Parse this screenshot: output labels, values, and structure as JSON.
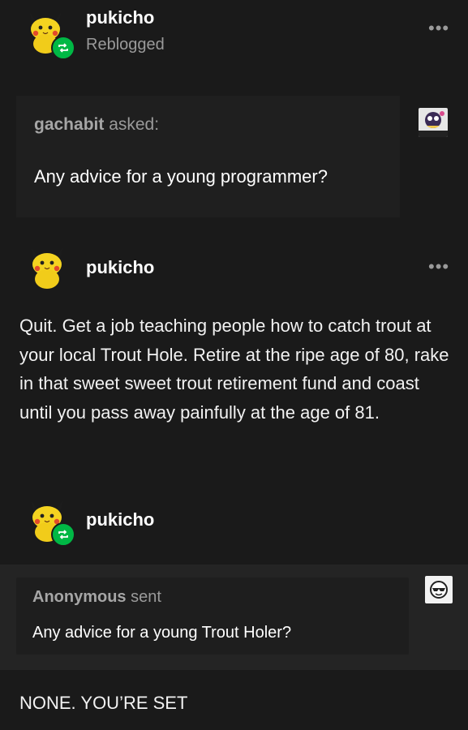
{
  "post": {
    "reblogger": {
      "username": "pukicho",
      "action": "Reblogged"
    },
    "ask1": {
      "asker": "gachabit",
      "verb": "asked:",
      "question": "Any advice for a young programmer?"
    },
    "reply1": {
      "username": "pukicho",
      "text": "Quit. Get a job teaching people how to catch trout at your local Trout Hole. Retire at the ripe age of 80, rake in that sweet sweet trout retirement fund and coast until you pass away painfully at the age of 81."
    },
    "reblog2": {
      "username": "pukicho"
    },
    "ask2": {
      "asker": "Anonymous",
      "verb": "sent",
      "question": "Any advice for a young Trout Holer?"
    },
    "reply2": {
      "text": "NONE. YOU’RE SET"
    },
    "more_label": "•••"
  },
  "colors": {
    "reblog_green": "#00b845",
    "background": "#1a1a1a",
    "muted_text": "#9a9a9a"
  },
  "icons": [
    "pikachu-avatar",
    "reblog-icon",
    "more-options-icon",
    "anonymous-avatar"
  ]
}
